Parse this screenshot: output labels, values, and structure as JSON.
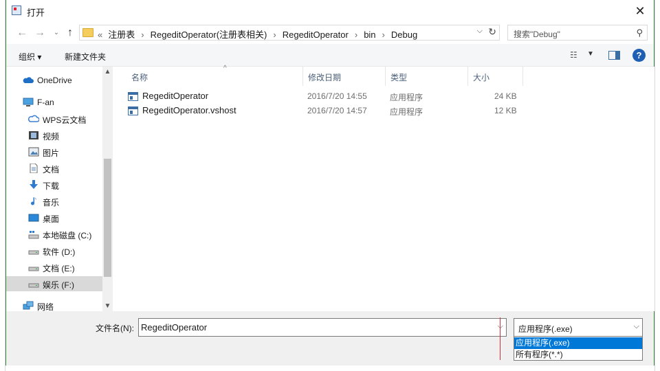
{
  "window": {
    "title": "打开",
    "close_glyph": "✕"
  },
  "address": {
    "overflow": "«",
    "crumbs": [
      "注册表",
      "RegeditOperator(注册表相关)",
      "RegeditOperator",
      "bin",
      "Debug"
    ],
    "separator": "›"
  },
  "search": {
    "placeholder": "搜索\"Debug\""
  },
  "toolbar": {
    "organize": "组织 ▾",
    "new_folder": "新建文件夹"
  },
  "nav": {
    "items": [
      {
        "label": "OneDrive",
        "icon": "cloud-icon"
      },
      {
        "label": "F-an",
        "icon": "computer-icon"
      },
      {
        "label": "WPS云文档",
        "icon": "wps-cloud-icon"
      },
      {
        "label": "视频",
        "icon": "video-icon"
      },
      {
        "label": "图片",
        "icon": "picture-icon"
      },
      {
        "label": "文档",
        "icon": "document-icon"
      },
      {
        "label": "下载",
        "icon": "download-icon"
      },
      {
        "label": "音乐",
        "icon": "music-icon"
      },
      {
        "label": "桌面",
        "icon": "desktop-icon"
      },
      {
        "label": "本地磁盘 (C:)",
        "icon": "drive-c-icon"
      },
      {
        "label": "软件 (D:)",
        "icon": "drive-icon"
      },
      {
        "label": "文档 (E:)",
        "icon": "drive-icon"
      },
      {
        "label": "娱乐 (F:)",
        "icon": "drive-icon",
        "selected": true
      },
      {
        "label": "网络",
        "icon": "network-icon"
      }
    ]
  },
  "columns": {
    "name": "名称",
    "date": "修改日期",
    "type": "类型",
    "size": "大小"
  },
  "files": [
    {
      "name": "RegeditOperator",
      "date": "2016/7/20 14:55",
      "type": "应用程序",
      "size": "24 KB"
    },
    {
      "name": "RegeditOperator.vshost",
      "date": "2016/7/20 14:57",
      "type": "应用程序",
      "size": "12 KB"
    }
  ],
  "filename": {
    "label": "文件名(N):",
    "value": "RegeditOperator"
  },
  "filter": {
    "selected": "应用程序(.exe)",
    "options": [
      "应用程序(.exe)",
      "所有程序(*.*)"
    ]
  },
  "colors": {
    "accent": "#0078d7",
    "help": "#1e5fb4",
    "header_text": "#4c607a"
  }
}
